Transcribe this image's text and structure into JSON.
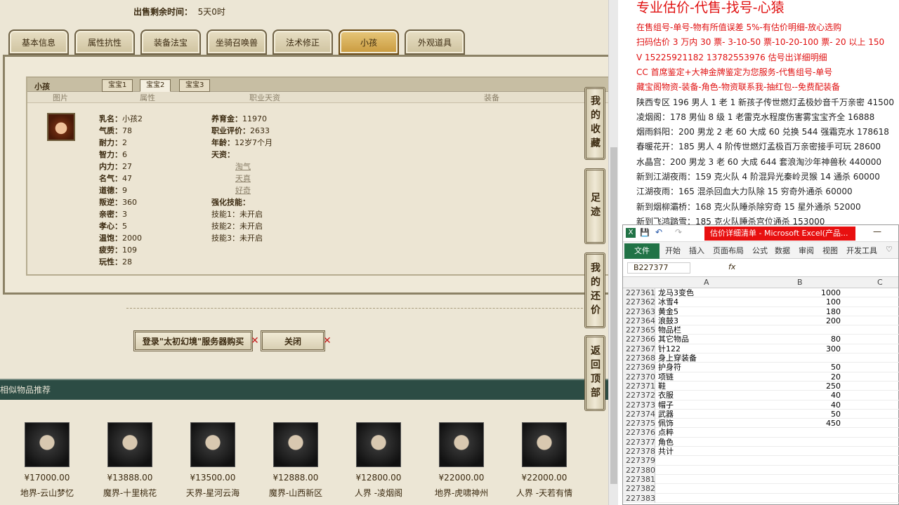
{
  "game": {
    "sell_time_label": "出售剩余时间：",
    "sell_time_value": "5天0时",
    "tabs": [
      "基本信息",
      "属性抗性",
      "装备法宝",
      "坐骑召唤兽",
      "法术修正",
      "小孩",
      "外观道具"
    ],
    "panel_title": "小孩",
    "subtabs": [
      "宝宝1",
      "宝宝2",
      "宝宝3"
    ],
    "headers": {
      "pic": "图片",
      "attr": "属性",
      "career": "职业天资",
      "equip": "装备"
    },
    "stats_left": [
      {
        "k": "乳名：",
        "v": "小孩2"
      },
      {
        "k": "气质：",
        "v": "78"
      },
      {
        "k": "耐力：",
        "v": "2"
      },
      {
        "k": "智力：",
        "v": "6"
      },
      {
        "k": "内力：",
        "v": "27"
      },
      {
        "k": "名气：",
        "v": "47"
      },
      {
        "k": "道德：",
        "v": "9"
      },
      {
        "k": "叛逆：",
        "v": "360"
      },
      {
        "k": "亲密：",
        "v": "3"
      },
      {
        "k": "孝心：",
        "v": "5"
      },
      {
        "k": "温饱：",
        "v": "2000"
      },
      {
        "k": "疲劳：",
        "v": "109"
      },
      {
        "k": "玩性：",
        "v": "28"
      }
    ],
    "stats_right": [
      {
        "k": "养育金：",
        "v": "11970"
      },
      {
        "k": "职业评价：",
        "v": "2633"
      },
      {
        "k": "年龄：",
        "v": "12岁7个月"
      },
      {
        "k": "天资：",
        "v": ""
      }
    ],
    "talents": [
      "淘气",
      "天真",
      "好奇"
    ],
    "skills_title": "强化技能：",
    "skills": [
      {
        "k": "技能1：",
        "v": "未开启"
      },
      {
        "k": "技能2：",
        "v": "未开启"
      },
      {
        "k": "技能3：",
        "v": "未开启"
      }
    ],
    "login_button": "登录\"太初幻境\"服务器购买",
    "close_button": "关闭",
    "similar_title": "相似物品推荐",
    "similar": [
      {
        "price": "¥17000.00",
        "name": "地界-云山梦忆"
      },
      {
        "price": "¥13888.00",
        "name": "魔界-十里桃花"
      },
      {
        "price": "¥13500.00",
        "name": "天界-星河云海"
      },
      {
        "price": "¥12888.00",
        "name": "魔界-山西新区"
      },
      {
        "price": "¥12800.00",
        "name": "人界 -凌烟阁"
      },
      {
        "price": "¥22000.00",
        "name": "地界-虎啸神州"
      },
      {
        "price": "¥22000.00",
        "name": "人界 -天若有情"
      }
    ],
    "side_buttons": [
      "我的收藏",
      "足迹",
      "我的还价",
      "返回顶部"
    ]
  },
  "ad": {
    "headline": "专业估价-代售-找号-心猿",
    "lines": [
      {
        "text": "在售组号-单号-物有所值误差 5%-有估价明细-放心选购",
        "red": true
      },
      {
        "text": "扫码估价 3 万内 30 票- 3-10-50 票-10-20-100 票- 20 以上 150",
        "red": true
      },
      {
        "text": "V 15225921182      13782553976    估号出详细明细",
        "red": true
      },
      {
        "text": "CC 首席鉴定+大神金牌鉴定为您服务-代售组号-单号",
        "red": true
      },
      {
        "text": "藏宝阁物资-装备-角色-物资联系我-抽红包--免费配装备",
        "red": true
      },
      {
        "text": "陕西专区 196 男人 1 老 1 新孩子传世燃灯孟极妙音千万亲密 41500",
        "red": false
      },
      {
        "text": "凌烟阁：178 男仙 8 级 1 老雷克水程度伤害雾宝宝齐全 16888",
        "red": false
      },
      {
        "text": "烟雨斜阳：200 男龙 2 老 60 大成 60 兑换 544 强霜克水 178618",
        "red": false
      },
      {
        "text": "春暖花开：185 男人 4 阶传世燃灯孟极百万亲密接手可玩 28600",
        "red": false
      },
      {
        "text": "水晶宫：200 男龙 3 老 60 大成 644 套浪淘沙年神兽秋 440000",
        "red": false
      },
      {
        "text": "新到江湖夜雨：159 克火队 4 阶混异光秦岭灵猴 14 通杀 60000",
        "red": false
      },
      {
        "text": "江湖夜雨：165 混杀回血大力队除 15 穷奇外通杀 60000",
        "red": false
      },
      {
        "text": "新到烟柳灞桥：168 克火队睡杀除穷奇 15 星外通杀 52000",
        "red": false
      },
      {
        "text": "新到飞鸿踏雪：185 克火队睡杀宫位通杀 153000",
        "red": false
      }
    ]
  },
  "excel": {
    "title": "估价详细清单 - Microsoft Excel(产品...",
    "file_tab": "文件",
    "tabs": [
      "开始",
      "插入",
      "页面布局",
      "公式",
      "数据",
      "审阅",
      "视图",
      "开发工具"
    ],
    "name_box": "B227377",
    "fx": "fx",
    "col_a": "A",
    "col_b": "B",
    "col_c": "C",
    "rows": [
      {
        "n": "227361",
        "a": "龙马3变色",
        "b": "1000"
      },
      {
        "n": "227362",
        "a": "冰雪4",
        "b": "100"
      },
      {
        "n": "227363",
        "a": "黄金5",
        "b": "180"
      },
      {
        "n": "227364",
        "a": "浪鼓3",
        "b": "200"
      },
      {
        "n": "227365",
        "a": "物品栏",
        "b": ""
      },
      {
        "n": "227366",
        "a": "其它物品",
        "b": "80"
      },
      {
        "n": "227367",
        "a": "针122",
        "b": "300"
      },
      {
        "n": "227368",
        "a": "身上穿装备",
        "b": ""
      },
      {
        "n": "227369",
        "a": "护身符",
        "b": "50"
      },
      {
        "n": "227370",
        "a": "项链",
        "b": "20"
      },
      {
        "n": "227371",
        "a": "鞋",
        "b": "250"
      },
      {
        "n": "227372",
        "a": "衣服",
        "b": "40"
      },
      {
        "n": "227373",
        "a": "帽子",
        "b": "40"
      },
      {
        "n": "227374",
        "a": "武器",
        "b": "50"
      },
      {
        "n": "227375",
        "a": "佩饰",
        "b": "450"
      },
      {
        "n": "227376",
        "a": "点粹",
        "b": ""
      },
      {
        "n": "227377",
        "a": "角色",
        "b": ""
      },
      {
        "n": "227378",
        "a": "共计",
        "b": ""
      },
      {
        "n": "227379",
        "a": "",
        "b": ""
      },
      {
        "n": "227380",
        "a": "",
        "b": ""
      },
      {
        "n": "227381",
        "a": "",
        "b": ""
      },
      {
        "n": "227382",
        "a": "",
        "b": ""
      },
      {
        "n": "227383",
        "a": "",
        "b": ""
      }
    ]
  }
}
